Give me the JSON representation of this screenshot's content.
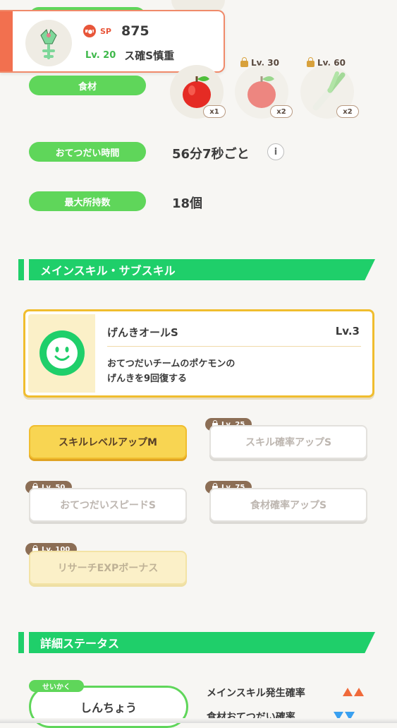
{
  "profile": {
    "sp_label": "SP",
    "sp_value": "875",
    "level": "Lv. 20",
    "name": "ス確S慎重"
  },
  "ingredients": {
    "label": "食材",
    "items": [
      {
        "lock_label": "",
        "count": "x1",
        "icon": "apple-icon"
      },
      {
        "lock_label": "Lv. 30",
        "count": "x2",
        "icon": "apple-icon"
      },
      {
        "lock_label": "Lv. 60",
        "count": "x2",
        "icon": "leek-icon"
      }
    ]
  },
  "help_time": {
    "label": "おてつだい時間",
    "value": "56分7秒ごと"
  },
  "max_carry": {
    "label": "最大所持数",
    "value": "18個"
  },
  "skill_section": {
    "title": "メインスキル・サブスキル"
  },
  "main_skill": {
    "name": "げんきオールS",
    "level": "Lv.3",
    "description_line1": "おてつだいチームのポケモンの",
    "description_line2": "げんきを9回復する"
  },
  "sub_skills": [
    {
      "label": "スキルレベルアップM",
      "lock": "",
      "state": "active"
    },
    {
      "label": "スキル確率アップS",
      "lock": "Lv. 25",
      "state": "locked"
    },
    {
      "label": "おてつだいスピードS",
      "lock": "Lv. 50",
      "state": "locked"
    },
    {
      "label": "食材確率アップS",
      "lock": "Lv. 75",
      "state": "locked"
    },
    {
      "label": "リサーチEXPボーナス",
      "lock": "Lv. 100",
      "state": "faded"
    }
  ],
  "detail_section": {
    "title": "詳細ステータス"
  },
  "nature": {
    "tag": "せいかく",
    "value": "しんちょう"
  },
  "stats": [
    {
      "label": "メインスキル発生確率",
      "indicator": "up"
    },
    {
      "label": "食材おてつだい確率",
      "indicator": "down"
    }
  ],
  "colors": {
    "accent_green": "#1fcf6a",
    "pill_green": "#5fd65a",
    "skill_yellow": "#f8d552",
    "up": "#f06a3a",
    "down": "#3aa0f0"
  }
}
